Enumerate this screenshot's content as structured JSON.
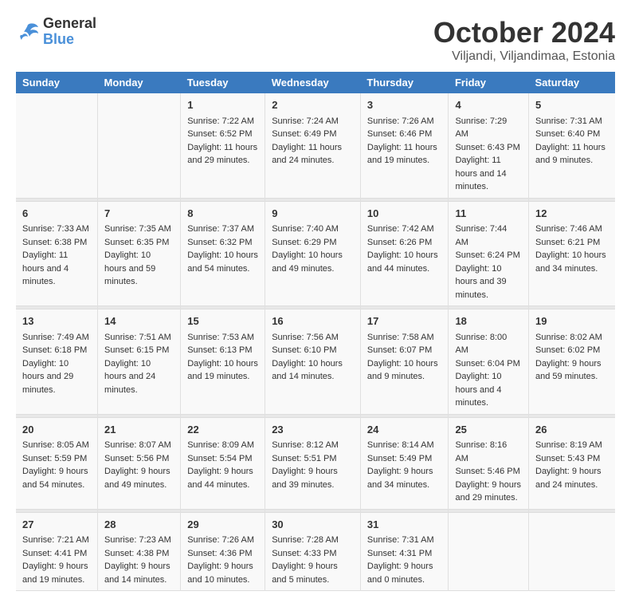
{
  "header": {
    "logo_line1": "General",
    "logo_line2": "Blue",
    "month": "October 2024",
    "location": "Viljandi, Viljandimaa, Estonia"
  },
  "columns": [
    "Sunday",
    "Monday",
    "Tuesday",
    "Wednesday",
    "Thursday",
    "Friday",
    "Saturday"
  ],
  "weeks": [
    [
      {
        "day": "",
        "sunrise": "",
        "sunset": "",
        "daylight": ""
      },
      {
        "day": "",
        "sunrise": "",
        "sunset": "",
        "daylight": ""
      },
      {
        "day": "1",
        "sunrise": "Sunrise: 7:22 AM",
        "sunset": "Sunset: 6:52 PM",
        "daylight": "Daylight: 11 hours and 29 minutes."
      },
      {
        "day": "2",
        "sunrise": "Sunrise: 7:24 AM",
        "sunset": "Sunset: 6:49 PM",
        "daylight": "Daylight: 11 hours and 24 minutes."
      },
      {
        "day": "3",
        "sunrise": "Sunrise: 7:26 AM",
        "sunset": "Sunset: 6:46 PM",
        "daylight": "Daylight: 11 hours and 19 minutes."
      },
      {
        "day": "4",
        "sunrise": "Sunrise: 7:29 AM",
        "sunset": "Sunset: 6:43 PM",
        "daylight": "Daylight: 11 hours and 14 minutes."
      },
      {
        "day": "5",
        "sunrise": "Sunrise: 7:31 AM",
        "sunset": "Sunset: 6:40 PM",
        "daylight": "Daylight: 11 hours and 9 minutes."
      }
    ],
    [
      {
        "day": "6",
        "sunrise": "Sunrise: 7:33 AM",
        "sunset": "Sunset: 6:38 PM",
        "daylight": "Daylight: 11 hours and 4 minutes."
      },
      {
        "day": "7",
        "sunrise": "Sunrise: 7:35 AM",
        "sunset": "Sunset: 6:35 PM",
        "daylight": "Daylight: 10 hours and 59 minutes."
      },
      {
        "day": "8",
        "sunrise": "Sunrise: 7:37 AM",
        "sunset": "Sunset: 6:32 PM",
        "daylight": "Daylight: 10 hours and 54 minutes."
      },
      {
        "day": "9",
        "sunrise": "Sunrise: 7:40 AM",
        "sunset": "Sunset: 6:29 PM",
        "daylight": "Daylight: 10 hours and 49 minutes."
      },
      {
        "day": "10",
        "sunrise": "Sunrise: 7:42 AM",
        "sunset": "Sunset: 6:26 PM",
        "daylight": "Daylight: 10 hours and 44 minutes."
      },
      {
        "day": "11",
        "sunrise": "Sunrise: 7:44 AM",
        "sunset": "Sunset: 6:24 PM",
        "daylight": "Daylight: 10 hours and 39 minutes."
      },
      {
        "day": "12",
        "sunrise": "Sunrise: 7:46 AM",
        "sunset": "Sunset: 6:21 PM",
        "daylight": "Daylight: 10 hours and 34 minutes."
      }
    ],
    [
      {
        "day": "13",
        "sunrise": "Sunrise: 7:49 AM",
        "sunset": "Sunset: 6:18 PM",
        "daylight": "Daylight: 10 hours and 29 minutes."
      },
      {
        "day": "14",
        "sunrise": "Sunrise: 7:51 AM",
        "sunset": "Sunset: 6:15 PM",
        "daylight": "Daylight: 10 hours and 24 minutes."
      },
      {
        "day": "15",
        "sunrise": "Sunrise: 7:53 AM",
        "sunset": "Sunset: 6:13 PM",
        "daylight": "Daylight: 10 hours and 19 minutes."
      },
      {
        "day": "16",
        "sunrise": "Sunrise: 7:56 AM",
        "sunset": "Sunset: 6:10 PM",
        "daylight": "Daylight: 10 hours and 14 minutes."
      },
      {
        "day": "17",
        "sunrise": "Sunrise: 7:58 AM",
        "sunset": "Sunset: 6:07 PM",
        "daylight": "Daylight: 10 hours and 9 minutes."
      },
      {
        "day": "18",
        "sunrise": "Sunrise: 8:00 AM",
        "sunset": "Sunset: 6:04 PM",
        "daylight": "Daylight: 10 hours and 4 minutes."
      },
      {
        "day": "19",
        "sunrise": "Sunrise: 8:02 AM",
        "sunset": "Sunset: 6:02 PM",
        "daylight": "Daylight: 9 hours and 59 minutes."
      }
    ],
    [
      {
        "day": "20",
        "sunrise": "Sunrise: 8:05 AM",
        "sunset": "Sunset: 5:59 PM",
        "daylight": "Daylight: 9 hours and 54 minutes."
      },
      {
        "day": "21",
        "sunrise": "Sunrise: 8:07 AM",
        "sunset": "Sunset: 5:56 PM",
        "daylight": "Daylight: 9 hours and 49 minutes."
      },
      {
        "day": "22",
        "sunrise": "Sunrise: 8:09 AM",
        "sunset": "Sunset: 5:54 PM",
        "daylight": "Daylight: 9 hours and 44 minutes."
      },
      {
        "day": "23",
        "sunrise": "Sunrise: 8:12 AM",
        "sunset": "Sunset: 5:51 PM",
        "daylight": "Daylight: 9 hours and 39 minutes."
      },
      {
        "day": "24",
        "sunrise": "Sunrise: 8:14 AM",
        "sunset": "Sunset: 5:49 PM",
        "daylight": "Daylight: 9 hours and 34 minutes."
      },
      {
        "day": "25",
        "sunrise": "Sunrise: 8:16 AM",
        "sunset": "Sunset: 5:46 PM",
        "daylight": "Daylight: 9 hours and 29 minutes."
      },
      {
        "day": "26",
        "sunrise": "Sunrise: 8:19 AM",
        "sunset": "Sunset: 5:43 PM",
        "daylight": "Daylight: 9 hours and 24 minutes."
      }
    ],
    [
      {
        "day": "27",
        "sunrise": "Sunrise: 7:21 AM",
        "sunset": "Sunset: 4:41 PM",
        "daylight": "Daylight: 9 hours and 19 minutes."
      },
      {
        "day": "28",
        "sunrise": "Sunrise: 7:23 AM",
        "sunset": "Sunset: 4:38 PM",
        "daylight": "Daylight: 9 hours and 14 minutes."
      },
      {
        "day": "29",
        "sunrise": "Sunrise: 7:26 AM",
        "sunset": "Sunset: 4:36 PM",
        "daylight": "Daylight: 9 hours and 10 minutes."
      },
      {
        "day": "30",
        "sunrise": "Sunrise: 7:28 AM",
        "sunset": "Sunset: 4:33 PM",
        "daylight": "Daylight: 9 hours and 5 minutes."
      },
      {
        "day": "31",
        "sunrise": "Sunrise: 7:31 AM",
        "sunset": "Sunset: 4:31 PM",
        "daylight": "Daylight: 9 hours and 0 minutes."
      },
      {
        "day": "",
        "sunrise": "",
        "sunset": "",
        "daylight": ""
      },
      {
        "day": "",
        "sunrise": "",
        "sunset": "",
        "daylight": ""
      }
    ]
  ]
}
